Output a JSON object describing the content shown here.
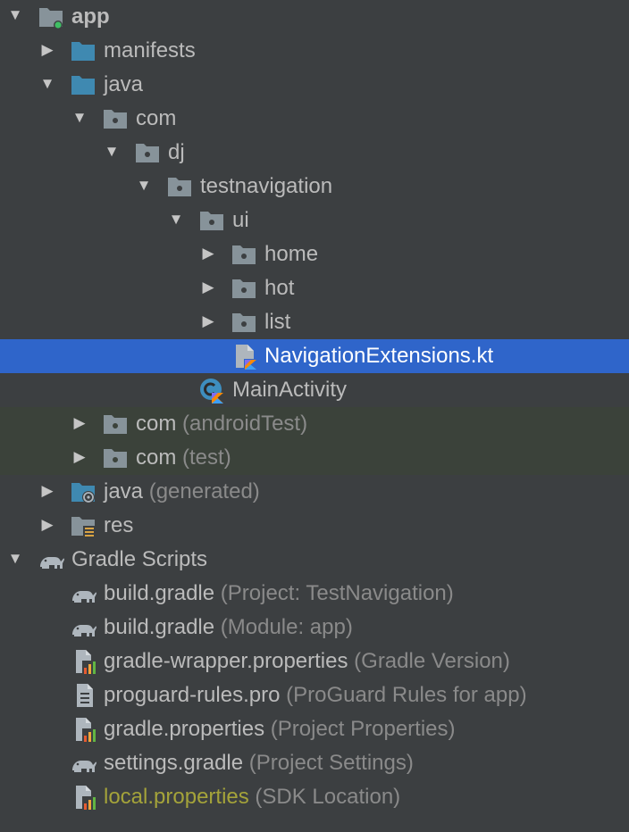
{
  "tree": {
    "rows": [
      {
        "label": "app",
        "hint": ""
      },
      {
        "label": "manifests",
        "hint": ""
      },
      {
        "label": "java",
        "hint": ""
      },
      {
        "label": "com",
        "hint": ""
      },
      {
        "label": "dj",
        "hint": ""
      },
      {
        "label": "testnavigation",
        "hint": ""
      },
      {
        "label": "ui",
        "hint": ""
      },
      {
        "label": "home",
        "hint": ""
      },
      {
        "label": "hot",
        "hint": ""
      },
      {
        "label": "list",
        "hint": ""
      },
      {
        "label": "NavigationExtensions.kt",
        "hint": ""
      },
      {
        "label": "MainActivity",
        "hint": ""
      },
      {
        "label": "com",
        "hint": "(androidTest)"
      },
      {
        "label": "com",
        "hint": "(test)"
      },
      {
        "label": "java",
        "hint": "(generated)"
      },
      {
        "label": "res",
        "hint": ""
      },
      {
        "label": "Gradle Scripts",
        "hint": ""
      },
      {
        "label": "build.gradle",
        "hint": "(Project: TestNavigation)"
      },
      {
        "label": "build.gradle",
        "hint": "(Module: app)"
      },
      {
        "label": "gradle-wrapper.properties",
        "hint": "(Gradle Version)"
      },
      {
        "label": "proguard-rules.pro",
        "hint": "(ProGuard Rules for app)"
      },
      {
        "label": "gradle.properties",
        "hint": "(Project Properties)"
      },
      {
        "label": "settings.gradle",
        "hint": "(Project Settings)"
      },
      {
        "label": "local.properties",
        "hint": "(SDK Location)"
      }
    ],
    "expanded_arrow": "▼",
    "collapsed_arrow": "▶"
  },
  "colors": {
    "background": "#3c3f41",
    "selection": "#2f65ca",
    "test_background": "#3b423a",
    "text": "#bbbbbb",
    "hint_text": "#8a8a8a",
    "modified_text": "#a4a33a"
  }
}
